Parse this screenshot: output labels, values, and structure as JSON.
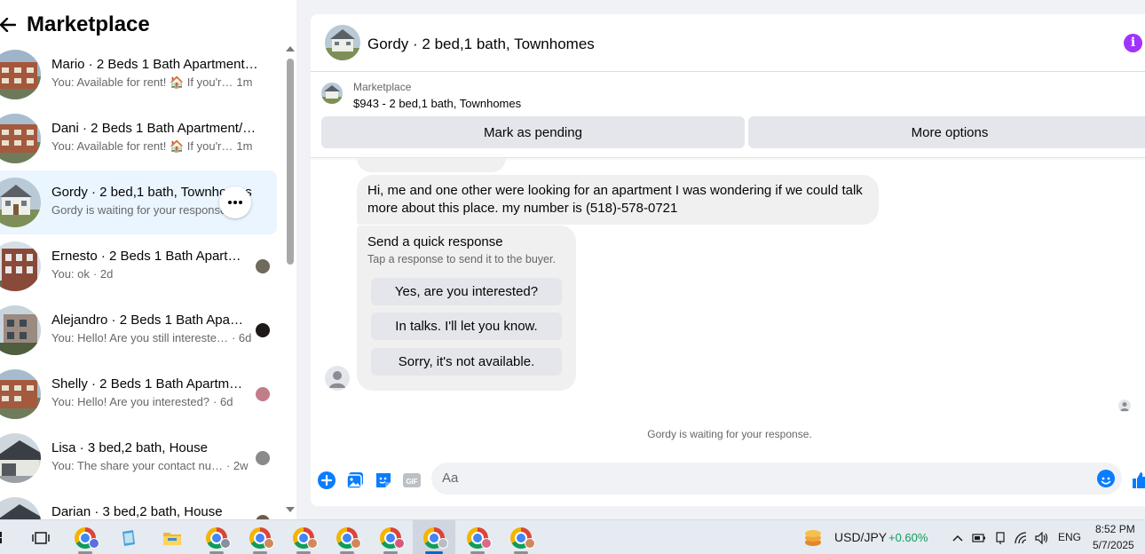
{
  "sidebar": {
    "title": "Marketplace",
    "conversations": [
      {
        "name": "Mario · 2 Beds 1 Bath Apartment/…",
        "snippet": "You: Available for rent! 🏠 If you'r…",
        "time": "1m",
        "active": false
      },
      {
        "name": "Dani · 2 Beds 1 Bath Apartment/…",
        "snippet": "You: Available for rent! 🏠 If you'r…",
        "time": "1m",
        "active": false
      },
      {
        "name": "Gordy · 2 bed,1 bath, Townhomes",
        "snippet": "Gordy is waiting for your response.",
        "time": "",
        "active": true
      },
      {
        "name": "Ernesto · 2 Beds 1 Bath Apart…",
        "snippet": "You: ok",
        "time": "· 2d",
        "active": false
      },
      {
        "name": "Alejandro · 2 Beds 1 Bath Apa…",
        "snippet": "You: Hello! Are you still intereste…",
        "time": "· 6d",
        "active": false
      },
      {
        "name": "Shelly · 2 Beds 1 Bath Apartm…",
        "snippet": "You: Hello! Are you interested?",
        "time": "· 6d",
        "active": false
      },
      {
        "name": "Lisa · 3 bed,2 bath, House",
        "snippet": "You: The share your contact nu…",
        "time": "· 2w",
        "active": false
      },
      {
        "name": "Darian · 3 bed,2 bath, House",
        "snippet": "",
        "time": "",
        "active": false
      }
    ]
  },
  "chat": {
    "title": "Gordy · 2 bed,1 bath, Townhomes",
    "listing_source": "Marketplace",
    "listing_detail": "$943 - 2 bed,1 bath, Townhomes",
    "mark_pending_label": "Mark as pending",
    "more_options_label": "More options",
    "message": "Hi, me and one other were looking for an apartment I was wondering if we could talk more about this place. my number is (518)-578-0721",
    "quick_response": {
      "title": "Send a quick response",
      "subtitle": "Tap a response to send it to the buyer.",
      "options": [
        "Yes, are you interested?",
        "In talks. I'll let you know.",
        "Sorry, it's not available."
      ]
    },
    "waiting_text": "Gordy is waiting for your response.",
    "composer_placeholder": "Aa"
  },
  "taskbar": {
    "ticker_label": "USD/JPY",
    "ticker_change": "+0.60%",
    "language": "ENG",
    "time": "8:52 PM",
    "date": "5/7/2025"
  },
  "colors": {
    "accent": "#0a7cff",
    "active_row": "#ebf5ff",
    "info": "#a033ff",
    "ticker_up": "#0f9d58"
  },
  "icons": [
    "back-arrow-icon",
    "more-dots-icon",
    "info-icon",
    "plus-circle-icon",
    "photo-icon",
    "sticker-icon",
    "gif-icon",
    "emoji-icon",
    "thumbs-up-icon",
    "windows-start-icon",
    "task-view-icon",
    "file-explorer-icon",
    "chrome-icon"
  ]
}
